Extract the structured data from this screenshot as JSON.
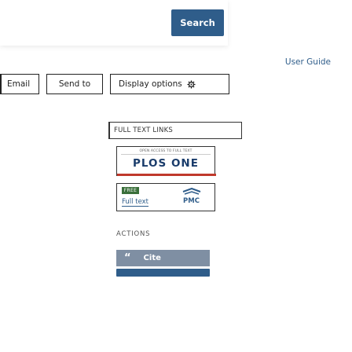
{
  "header": {
    "search_label": "Search",
    "user_guide_label": "User Guide"
  },
  "toolbar": {
    "email_label": "Email",
    "send_to_label": "Send to",
    "display_options_label": "Display options",
    "display_options_icon": "gear-icon"
  },
  "full_text_links": {
    "heading": "FULL TEXT LINKS",
    "plos": {
      "strip_text": "OPEN ACCESS TO FULL TEXT",
      "logo_text": "PLOS ONE"
    },
    "pmc": {
      "badge": "FREE",
      "full_text_label": "Full text",
      "logo_text": "PMC"
    }
  },
  "actions": {
    "heading": "ACTIONS",
    "cite_label": "Cite",
    "cite_icon": "quote-icon"
  },
  "colors": {
    "accent": "#2f5d8a",
    "cite_bg": "#7f8fa3"
  }
}
